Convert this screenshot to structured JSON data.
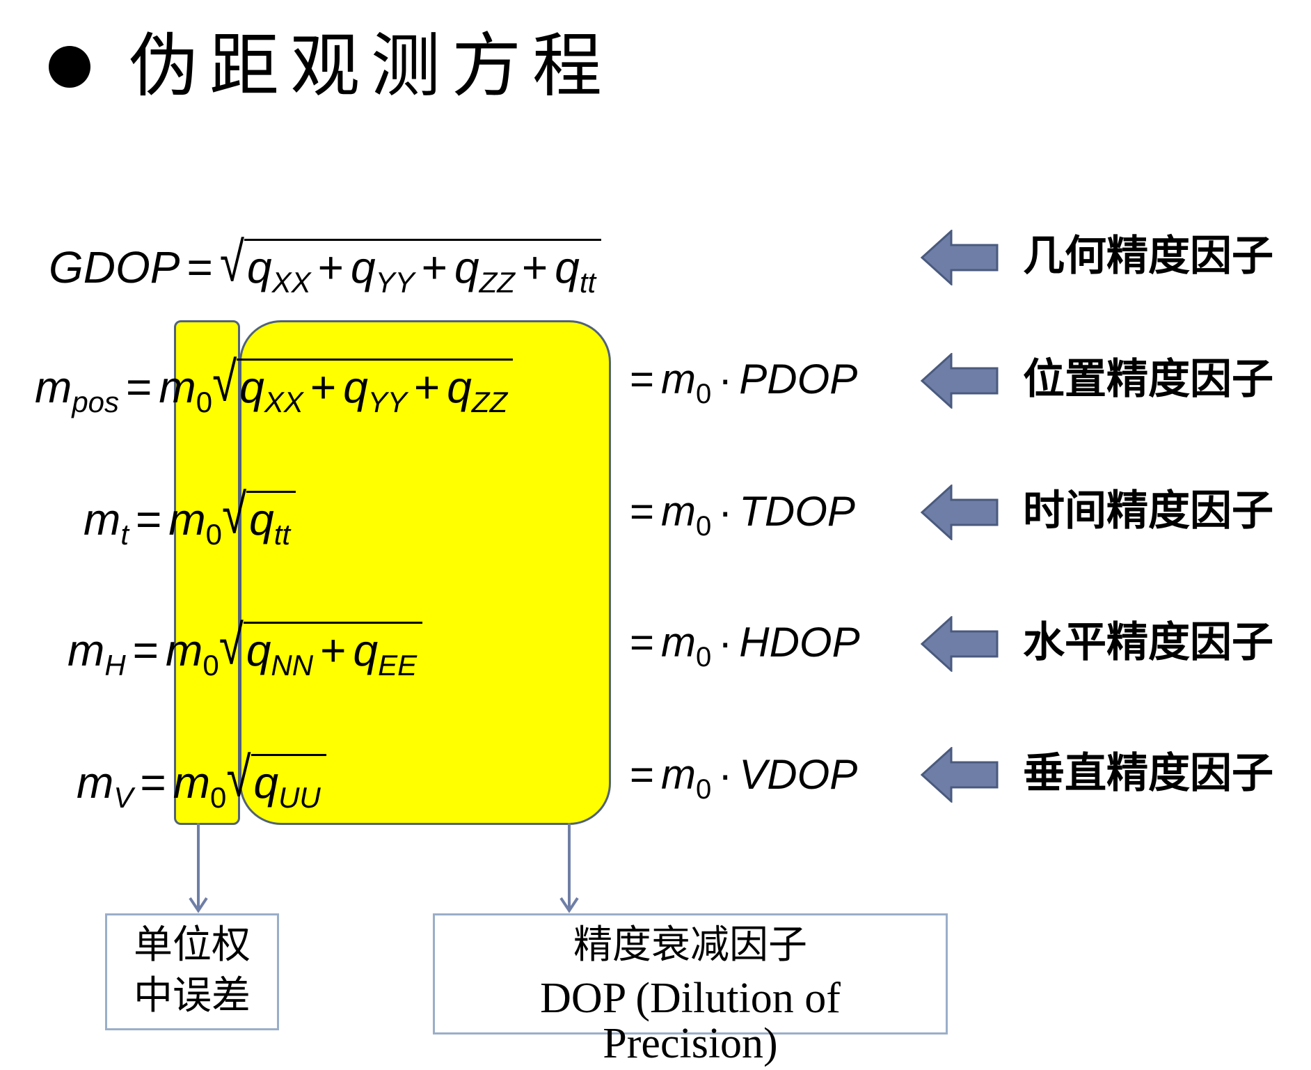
{
  "title": "伪距观测方程",
  "equations": {
    "gdop": {
      "lhs": "GDOP",
      "terms": [
        "XX",
        "YY",
        "ZZ",
        "tt"
      ]
    },
    "pos": {
      "lhs_sub": "pos",
      "terms": [
        "XX",
        "YY",
        "ZZ"
      ],
      "rhs": "PDOP"
    },
    "t": {
      "lhs_sub": "t",
      "terms": [
        "tt"
      ],
      "rhs": "TDOP"
    },
    "h": {
      "lhs_sub": "H",
      "terms": [
        "NN",
        "EE"
      ],
      "rhs": "HDOP"
    },
    "v": {
      "lhs_sub": "V",
      "terms": [
        "UU"
      ],
      "rhs": "VDOP"
    },
    "m": "m",
    "m0_sub": "0",
    "q": "q"
  },
  "factor_labels": {
    "gdop": "几何精度因子",
    "pdop": "位置精度因子",
    "tdop": "时间精度因子",
    "hdop": "水平精度因子",
    "vdop": "垂直精度因子"
  },
  "bottom_boxes": {
    "unit_weight": [
      "单位权",
      "中误差"
    ],
    "dop_cn": "精度衰减因子",
    "dop_en": [
      "DOP (Dilution of",
      "Precision)"
    ]
  },
  "colors": {
    "highlight": "#ffff00",
    "highlight_border": "#51627a",
    "arrow_fill": "#6e7ea6",
    "arrow_stroke": "#4a5a7e",
    "box_border": "#9aaec8"
  }
}
